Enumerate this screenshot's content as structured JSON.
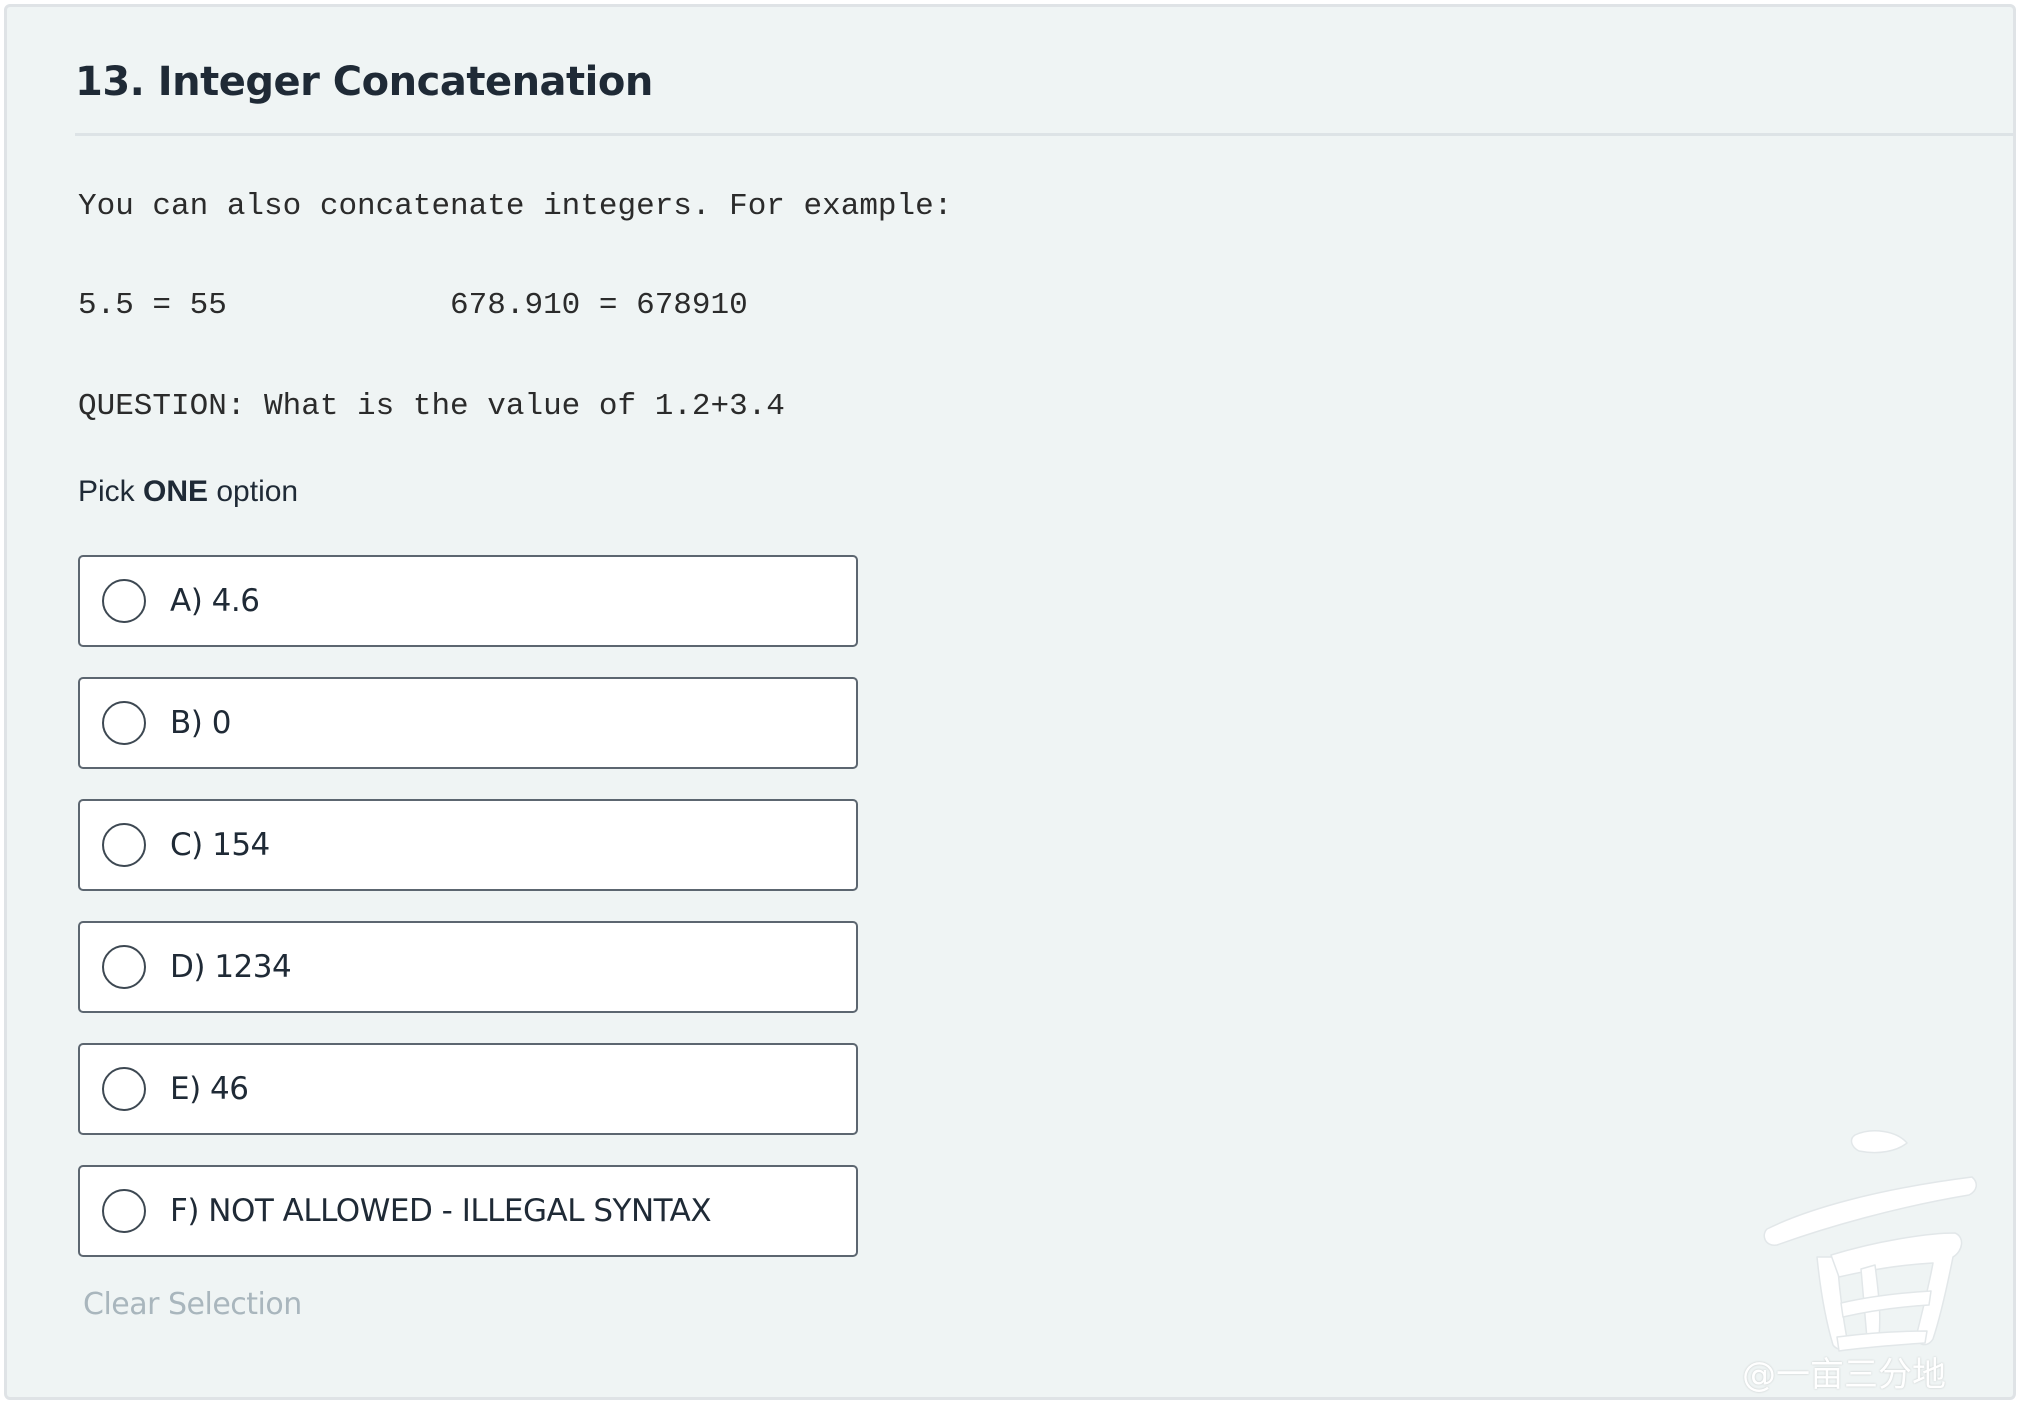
{
  "question": {
    "title": "13. Integer Concatenation",
    "intro": "You can also concatenate integers. For example:",
    "examples": "5.5 = 55            678.910 = 678910",
    "prompt": "QUESTION: What is the value of 1.2+3.4"
  },
  "instructions": {
    "prefix": "Pick ",
    "emphasis": "ONE",
    "suffix": " option"
  },
  "options": [
    {
      "label": "A) 4.6",
      "selected": false
    },
    {
      "label": "B) 0",
      "selected": false
    },
    {
      "label": "C) 154",
      "selected": false
    },
    {
      "label": "D) 1234",
      "selected": false
    },
    {
      "label": "E) 46",
      "selected": false
    },
    {
      "label": "F) NOT ALLOWED - ILLEGAL SYNTAX",
      "selected": false
    }
  ],
  "clear_label": "Clear Selection",
  "watermark": {
    "logo_glyph": "亩",
    "text": "@一亩三分地"
  },
  "colors": {
    "card_background": "#eff4f4",
    "title_text": "#1f2a36",
    "option_border": "#5c6670",
    "clear_link": "#a9b6bd"
  }
}
